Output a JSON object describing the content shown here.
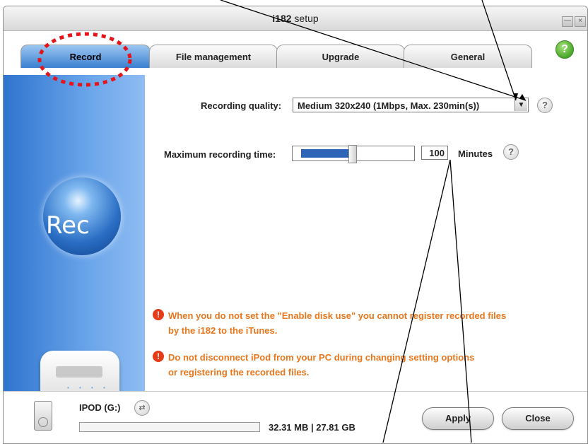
{
  "window": {
    "title_brand": "i182",
    "title_rest": " setup",
    "minimize_glyph": "—",
    "close_glyph": "×"
  },
  "help_glyph": "?",
  "tabs": [
    {
      "label": "Record",
      "active": true
    },
    {
      "label": "File management",
      "active": false
    },
    {
      "label": "Upgrade",
      "active": false
    },
    {
      "label": "General",
      "active": false
    }
  ],
  "sidebar": {
    "rec_label": "Rec"
  },
  "recording": {
    "quality_label": "Recording quality:",
    "quality_value": "Medium 320x240 (1Mbps, Max. 230min(s))",
    "max_time_label": "Maximum recording time:",
    "max_time_value": "100",
    "max_time_unit": "Minutes",
    "slider_level": 0.45
  },
  "warnings": [
    {
      "line1": "When you do not set the \"Enable disk use\" you cannot register recorded files",
      "line2": "by the i182 to the iTunes."
    },
    {
      "line1": "Do not disconnect iPod from your PC during changing setting options",
      "line2": "or registering the recorded files."
    }
  ],
  "status": {
    "device_label": "IPOD (G:)",
    "storage": "32.31 MB | 27.81 GB",
    "storage_fill": 0.0
  },
  "buttons": {
    "apply": "Apply",
    "close": "Close"
  },
  "colors": {
    "accent": "#2e64b8",
    "warning": "#e8761c",
    "annotation": "#e4141a"
  }
}
